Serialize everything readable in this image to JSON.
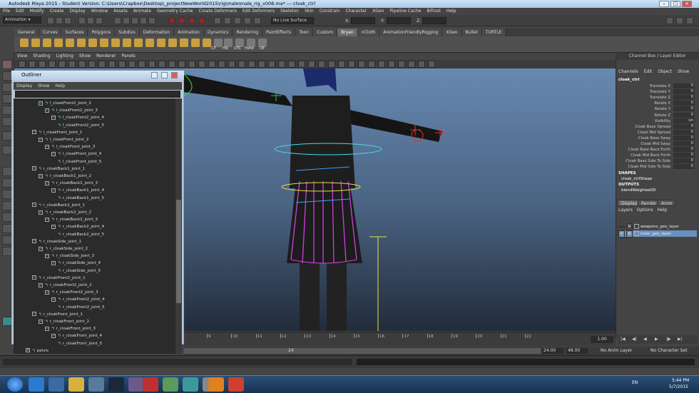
{
  "window": {
    "title": "Autodesk Maya 2015 - Student Version: C:\\Users\\Crapbox\\Desktop\\_projectNewWorld2015\\rig\\male\\male_rig_v008.ma*   ---   cloak_ctrl"
  },
  "menubar": {
    "items": [
      "File",
      "Edit",
      "Modify",
      "Create",
      "Display",
      "Window",
      "Assets",
      "Animate",
      "Geometry Cache",
      "Create Deformers",
      "Edit Deformers",
      "Skeleton",
      "Skin",
      "Constrain",
      "Character",
      "XGen",
      "Pipeline Cache",
      "Bifrost",
      "Help"
    ]
  },
  "statusline": {
    "mode": "Animation",
    "live_surface": "No Live Surface",
    "x_label": "X:",
    "y_label": "Y:",
    "z_label": "Z:"
  },
  "shelf": {
    "tabs": [
      "General",
      "Curves",
      "Surfaces",
      "Polygons",
      "Subdivs",
      "Deformation",
      "Animation",
      "Dynamics",
      "Rendering",
      "PaintEffects",
      "Toon",
      "Custom",
      "Bryan",
      "nCloth",
      "AnimationFriendlyRigging",
      "XGen",
      "Bullet",
      "TURTLE"
    ],
    "active_tab": "Bryan",
    "labels": [
      "CP",
      "Hik",
      "UTC",
      "Hshd",
      "DE"
    ]
  },
  "viewport": {
    "menu": [
      "View",
      "Shading",
      "Lighting",
      "Show",
      "Renderer",
      "Panels"
    ]
  },
  "outliner": {
    "title": "Outliner",
    "menu": [
      "Display",
      "Show",
      "Help"
    ],
    "rows": [
      {
        "indent": 3,
        "pm": "−",
        "label": "l_cloakFront2_joint_2"
      },
      {
        "indent": 4,
        "pm": "−",
        "label": "l_cloakFront2_joint_3"
      },
      {
        "indent": 5,
        "pm": "−",
        "label": "l_cloakFront2_joint_4"
      },
      {
        "indent": 6,
        "pm": "",
        "label": "l_cloakFront2_joint_5"
      },
      {
        "indent": 2,
        "pm": "−",
        "label": "l_cloakFront_joint_1"
      },
      {
        "indent": 3,
        "pm": "−",
        "label": "l_cloakFront_joint_2"
      },
      {
        "indent": 4,
        "pm": "−",
        "label": "l_cloakFront_joint_3"
      },
      {
        "indent": 5,
        "pm": "−",
        "label": "l_cloakFront_joint_4"
      },
      {
        "indent": 6,
        "pm": "",
        "label": "l_cloakFront_joint_5"
      },
      {
        "indent": 2,
        "pm": "−",
        "label": "r_cloakBack1_joint_1"
      },
      {
        "indent": 3,
        "pm": "−",
        "label": "r_cloakBack1_joint_2"
      },
      {
        "indent": 4,
        "pm": "−",
        "label": "r_cloakBack1_joint_3"
      },
      {
        "indent": 5,
        "pm": "−",
        "label": "r_cloakBack1_joint_4"
      },
      {
        "indent": 6,
        "pm": "",
        "label": "r_cloakBack1_joint_5"
      },
      {
        "indent": 2,
        "pm": "−",
        "label": "r_cloakBack2_joint_1"
      },
      {
        "indent": 3,
        "pm": "−",
        "label": "r_cloakBack2_joint_2"
      },
      {
        "indent": 4,
        "pm": "−",
        "label": "r_cloakBack2_joint_3"
      },
      {
        "indent": 5,
        "pm": "−",
        "label": "r_cloakBack2_joint_4"
      },
      {
        "indent": 6,
        "pm": "",
        "label": "r_cloakBack2_joint_5"
      },
      {
        "indent": 2,
        "pm": "−",
        "label": "r_cloakSide_joint_1"
      },
      {
        "indent": 3,
        "pm": "−",
        "label": "r_cloakSide_joint_2"
      },
      {
        "indent": 4,
        "pm": "−",
        "label": "r_cloakSide_joint_3"
      },
      {
        "indent": 5,
        "pm": "−",
        "label": "r_cloakSide_joint_4"
      },
      {
        "indent": 6,
        "pm": "",
        "label": "r_cloakSide_joint_5"
      },
      {
        "indent": 2,
        "pm": "−",
        "label": "r_cloakFront2_joint_1"
      },
      {
        "indent": 3,
        "pm": "−",
        "label": "r_cloakFront2_joint_2"
      },
      {
        "indent": 4,
        "pm": "−",
        "label": "r_cloakFront2_joint_3"
      },
      {
        "indent": 5,
        "pm": "−",
        "label": "r_cloakFront2_joint_4"
      },
      {
        "indent": 6,
        "pm": "",
        "label": "r_cloakFront2_joint_5"
      },
      {
        "indent": 2,
        "pm": "−",
        "label": "r_cloakFront_joint_1"
      },
      {
        "indent": 3,
        "pm": "−",
        "label": "r_cloakFront_joint_2"
      },
      {
        "indent": 4,
        "pm": "−",
        "label": "r_cloakFront_joint_3"
      },
      {
        "indent": 5,
        "pm": "−",
        "label": "r_cloakFront_joint_4"
      },
      {
        "indent": 6,
        "pm": "",
        "label": "r_cloakFront_joint_5"
      },
      {
        "indent": 1,
        "pm": "+",
        "label": "pelvis"
      }
    ]
  },
  "channelbox": {
    "title": "Channel Box / Layer Editor",
    "menu": [
      "Channels",
      "Edit",
      "Object",
      "Show"
    ],
    "object": "cloak_ctrl",
    "attrs": [
      {
        "name": "Translate X",
        "value": "0"
      },
      {
        "name": "Translate Y",
        "value": "0"
      },
      {
        "name": "Translate Z",
        "value": "0"
      },
      {
        "name": "Rotate X",
        "value": "0"
      },
      {
        "name": "Rotate Y",
        "value": "0"
      },
      {
        "name": "Rotate Z",
        "value": "0"
      },
      {
        "name": "Visibility",
        "value": "on"
      },
      {
        "name": "Cloak Base Spread",
        "value": "0"
      },
      {
        "name": "Cloak Mid Spread",
        "value": "0"
      },
      {
        "name": "Cloak Base Sway",
        "value": "0"
      },
      {
        "name": "Cloak Mid Sway",
        "value": "0"
      },
      {
        "name": "Cloak Base Back Forth",
        "value": "0"
      },
      {
        "name": "Cloak Mid Back Forth",
        "value": "0"
      },
      {
        "name": "Cloak Base Side To Side",
        "value": "0"
      },
      {
        "name": "Cloak Mid Side To Side",
        "value": "0"
      }
    ],
    "shapes_label": "SHAPES",
    "shape": "cloak_ctrlShape",
    "outputs_label": "OUTPUTS",
    "output": "blendWeighted30"
  },
  "layereditor": {
    "tabs": [
      "Display",
      "Render",
      "Anim"
    ],
    "menu": [
      "Layers",
      "Options",
      "Help"
    ],
    "layers": [
      {
        "v": "",
        "r": "R",
        "name": "weapons_geo_layer",
        "selected": false
      },
      {
        "v": "V",
        "r": "R",
        "name": "male_geo_layer",
        "selected": true
      }
    ]
  },
  "timeslider": {
    "ticks": [
      "9",
      "10",
      "11",
      "12",
      "13",
      "14",
      "15",
      "16",
      "17",
      "18",
      "19",
      "20",
      "21",
      "22"
    ],
    "current": "1.00"
  },
  "rangeslider": {
    "mid": "24",
    "end": "24.00",
    "max": "48.00",
    "anim_layer": "No Anim Layer",
    "char_set": "No Character Set"
  },
  "taskbar": {
    "lang": "EN",
    "time": "5:44 PM",
    "date": "5/7/2015"
  },
  "colors": {
    "joint": "#7fd0ff",
    "curve_magenta": "#d040e0",
    "curve_cyan": "#40e0e0",
    "layer_selected": "#6a90c0"
  }
}
